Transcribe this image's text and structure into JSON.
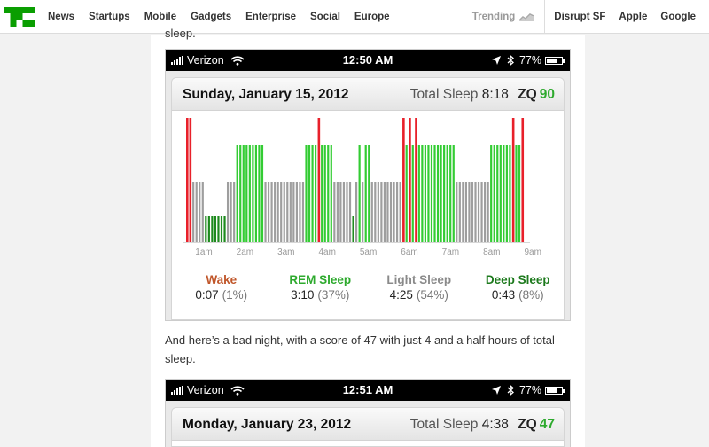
{
  "nav": {
    "links": [
      "News",
      "Startups",
      "Mobile",
      "Gadgets",
      "Enterprise",
      "Social",
      "Europe"
    ],
    "trending_label": "Trending",
    "trending_links": [
      "Disrupt SF",
      "Apple",
      "Google"
    ]
  },
  "article": {
    "cut_text": "sleep.",
    "paragraph": "And here’s a bad night, with a score of 47 with just 4 and a half hours of total sleep."
  },
  "screens": [
    {
      "status": {
        "carrier": "Verizon",
        "time": "12:50 AM",
        "battery": "77%",
        "battery_level": 0.77
      },
      "date": "Sunday, January 15, 2012",
      "total_sleep_label": "Total Sleep",
      "total_sleep": "8:18",
      "zq_label": "ZQ",
      "zq": "90",
      "chart_data": {
        "type": "bar",
        "x_tick_labels": [
          "1am",
          "2am",
          "3am",
          "4am",
          "5am",
          "6am",
          "7am",
          "8am",
          "9am"
        ],
        "y_levels": [
          "deep",
          "light",
          "rem",
          "wake"
        ],
        "segments": [
          {
            "stage": "wake",
            "bars": 2
          },
          {
            "stage": "light",
            "bars": 4
          },
          {
            "stage": "deep",
            "bars": 7
          },
          {
            "stage": "light",
            "bars": 3
          },
          {
            "stage": "rem",
            "bars": 9
          },
          {
            "stage": "light",
            "bars": 13
          },
          {
            "stage": "rem",
            "bars": 4
          },
          {
            "stage": "wake",
            "bars": 1
          },
          {
            "stage": "rem",
            "bars": 4
          },
          {
            "stage": "light",
            "bars": 6
          },
          {
            "stage": "deep",
            "bars": 1
          },
          {
            "stage": "light",
            "bars": 1
          },
          {
            "stage": "rem",
            "bars": 1
          },
          {
            "stage": "light",
            "bars": 1
          },
          {
            "stage": "rem",
            "bars": 2
          },
          {
            "stage": "light",
            "bars": 10
          },
          {
            "stage": "wake",
            "bars": 1
          },
          {
            "stage": "rem",
            "bars": 1
          },
          {
            "stage": "wake",
            "bars": 1
          },
          {
            "stage": "rem",
            "bars": 1
          },
          {
            "stage": "wake",
            "bars": 1
          },
          {
            "stage": "rem",
            "bars": 12
          },
          {
            "stage": "light",
            "bars": 11
          },
          {
            "stage": "rem",
            "bars": 7
          },
          {
            "stage": "wake",
            "bars": 1
          },
          {
            "stage": "rem",
            "bars": 2
          },
          {
            "stage": "wake",
            "bars": 1
          }
        ],
        "colors": {
          "wake": "#e8202a",
          "rem": "#33cc33",
          "light": "#9e9e9e",
          "deep": "#1d8a1d"
        }
      },
      "legend": [
        {
          "name": "Wake",
          "time": "0:07",
          "pct": "(1%)",
          "color": "#c0572b"
        },
        {
          "name": "REM Sleep",
          "time": "3:10",
          "pct": "(37%)",
          "color": "#2eaa2e"
        },
        {
          "name": "Light Sleep",
          "time": "4:25",
          "pct": "(54%)",
          "color": "#8a8a8a"
        },
        {
          "name": "Deep Sleep",
          "time": "0:43",
          "pct": "(8%)",
          "color": "#1d7a1d"
        }
      ]
    },
    {
      "status": {
        "carrier": "Verizon",
        "time": "12:51 AM",
        "battery": "77%",
        "battery_level": 0.77
      },
      "date": "Monday, January 23, 2012",
      "total_sleep_label": "Total Sleep",
      "total_sleep": "4:38",
      "zq_label": "ZQ",
      "zq": "47"
    }
  ]
}
